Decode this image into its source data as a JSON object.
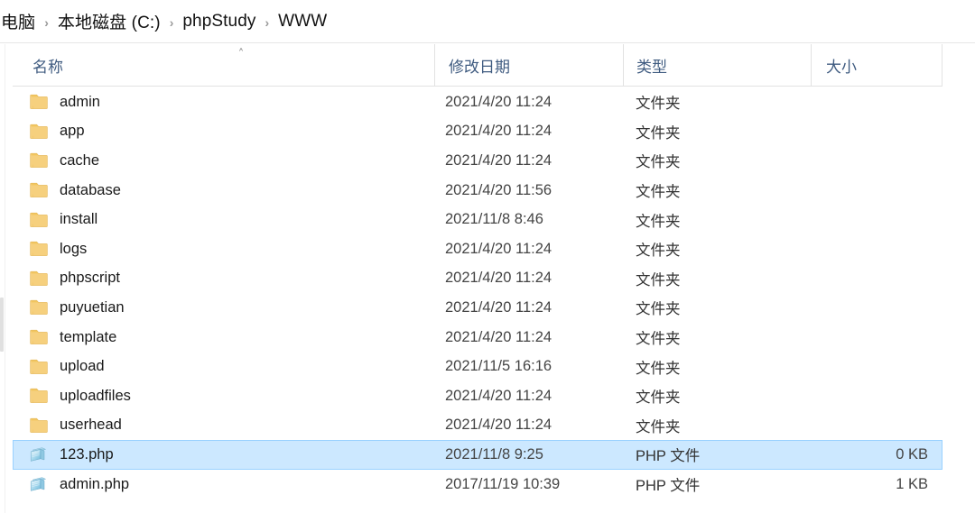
{
  "window": {
    "title": "WWW"
  },
  "breadcrumb": {
    "separator": "›",
    "items": [
      {
        "label": "电脑"
      },
      {
        "label": "本地磁盘 (C:)"
      },
      {
        "label": "phpStudy"
      },
      {
        "label": "WWW"
      }
    ]
  },
  "columns": {
    "sort_caret": "˄",
    "name": "名称",
    "date": "修改日期",
    "type": "类型",
    "size": "大小"
  },
  "types": {
    "folder": "文件夹",
    "php": "PHP 文件"
  },
  "colors": {
    "selection_fill": "#cce8ff",
    "selection_border": "#99d1ff",
    "header_text": "#3f5b80",
    "folder_icon": "#f7d27f",
    "php_icon": "#7ec8e8"
  },
  "files": [
    {
      "name": "admin",
      "icon": "folder-icon",
      "date": "2021/4/20 11:24",
      "type": "文件夹",
      "size": "",
      "selected": false
    },
    {
      "name": "app",
      "icon": "folder-icon",
      "date": "2021/4/20 11:24",
      "type": "文件夹",
      "size": "",
      "selected": false
    },
    {
      "name": "cache",
      "icon": "folder-icon",
      "date": "2021/4/20 11:24",
      "type": "文件夹",
      "size": "",
      "selected": false
    },
    {
      "name": "database",
      "icon": "folder-icon",
      "date": "2021/4/20 11:56",
      "type": "文件夹",
      "size": "",
      "selected": false
    },
    {
      "name": "install",
      "icon": "folder-icon",
      "date": "2021/11/8 8:46",
      "type": "文件夹",
      "size": "",
      "selected": false
    },
    {
      "name": "logs",
      "icon": "folder-icon",
      "date": "2021/4/20 11:24",
      "type": "文件夹",
      "size": "",
      "selected": false
    },
    {
      "name": "phpscript",
      "icon": "folder-icon",
      "date": "2021/4/20 11:24",
      "type": "文件夹",
      "size": "",
      "selected": false
    },
    {
      "name": "puyuetian",
      "icon": "folder-icon",
      "date": "2021/4/20 11:24",
      "type": "文件夹",
      "size": "",
      "selected": false
    },
    {
      "name": "template",
      "icon": "folder-icon",
      "date": "2021/4/20 11:24",
      "type": "文件夹",
      "size": "",
      "selected": false
    },
    {
      "name": "upload",
      "icon": "folder-icon",
      "date": "2021/11/5 16:16",
      "type": "文件夹",
      "size": "",
      "selected": false
    },
    {
      "name": "uploadfiles",
      "icon": "folder-icon",
      "date": "2021/4/20 11:24",
      "type": "文件夹",
      "size": "",
      "selected": false
    },
    {
      "name": "userhead",
      "icon": "folder-icon",
      "date": "2021/4/20 11:24",
      "type": "文件夹",
      "size": "",
      "selected": false
    },
    {
      "name": "123.php",
      "icon": "php-file-icon",
      "date": "2021/11/8 9:25",
      "type": "PHP 文件",
      "size": "0 KB",
      "selected": true
    },
    {
      "name": "admin.php",
      "icon": "php-file-icon",
      "date": "2017/11/19 10:39",
      "type": "PHP 文件",
      "size": "1 KB",
      "selected": false
    }
  ]
}
